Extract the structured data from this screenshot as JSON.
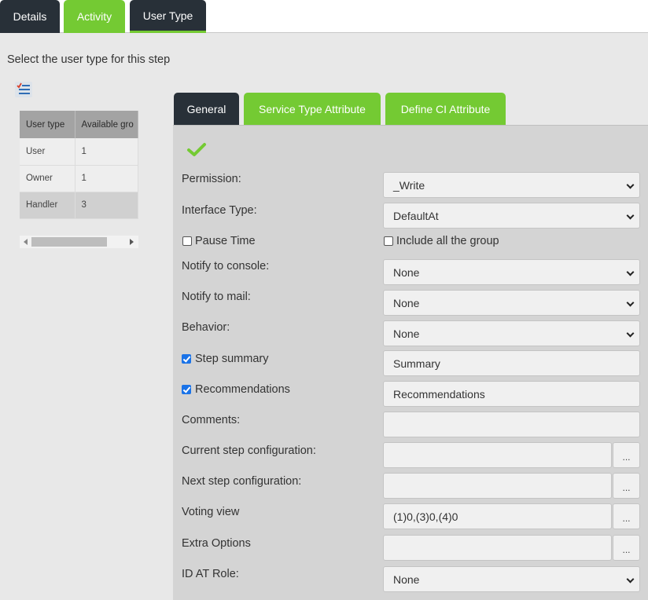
{
  "top_tabs": [
    {
      "label": "Details"
    },
    {
      "label": "Activity"
    },
    {
      "label": "User Type"
    }
  ],
  "instruction": "Select the user type for this step",
  "grid": {
    "headers": [
      "User type",
      "Available gro"
    ],
    "rows": [
      {
        "type": "User",
        "count": "1"
      },
      {
        "type": "Owner",
        "count": "1"
      },
      {
        "type": "Handler",
        "count": "3"
      }
    ],
    "selected_row": 2
  },
  "sub_tabs": [
    {
      "label": "General"
    },
    {
      "label": "Service Type Attribute"
    },
    {
      "label": "Define CI Attribute"
    }
  ],
  "form": {
    "permission": {
      "label": "Permission:",
      "value": "_Write"
    },
    "interface_type": {
      "label": "Interface Type:",
      "value": "DefaultAt"
    },
    "pause_time": {
      "label": "Pause Time",
      "checked": false
    },
    "include_all_group": {
      "label": "Include all the group",
      "checked": false
    },
    "notify_console": {
      "label": "Notify to console:",
      "value": "None"
    },
    "notify_mail": {
      "label": "Notify to mail:",
      "value": "None"
    },
    "behavior": {
      "label": "Behavior:",
      "value": "None"
    },
    "step_summary": {
      "label": "Step summary",
      "checked": true,
      "value": "Summary"
    },
    "recommendations": {
      "label": "Recommendations",
      "checked": true,
      "value": "Recommendations"
    },
    "comments": {
      "label": "Comments:",
      "value": ""
    },
    "current_step_config": {
      "label": "Current step configuration:",
      "value": "",
      "button": "..."
    },
    "next_step_config": {
      "label": "Next step configuration:",
      "value": "",
      "button": "..."
    },
    "voting_view": {
      "label": "Voting view",
      "value": "(1)0,(3)0,(4)0",
      "button": "..."
    },
    "extra_options": {
      "label": "Extra Options",
      "value": "",
      "button": "..."
    },
    "id_at_role": {
      "label": "ID AT Role:",
      "value": "None"
    }
  },
  "colors": {
    "dark_tab": "#283038",
    "accent_green": "#74ca33",
    "checkbox_blue": "#1a73e8"
  },
  "icons": [
    "list-check-icon",
    "checkmark-icon",
    "chevron-down-icon"
  ]
}
